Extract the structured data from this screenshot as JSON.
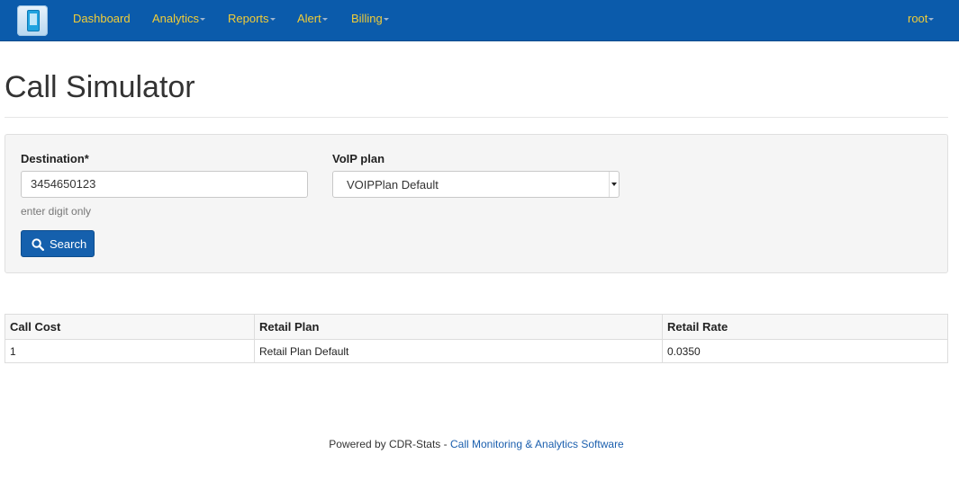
{
  "nav": {
    "items": [
      {
        "label": "Dashboard",
        "dropdown": false
      },
      {
        "label": "Analytics",
        "dropdown": true
      },
      {
        "label": "Reports",
        "dropdown": true
      },
      {
        "label": "Alert",
        "dropdown": true
      },
      {
        "label": "Billing",
        "dropdown": true
      }
    ],
    "user": "root"
  },
  "page": {
    "title": "Call Simulator"
  },
  "form": {
    "destination_label": "Destination*",
    "destination_value": "3454650123",
    "destination_help": "enter digit only",
    "voip_label": "VoIP plan",
    "voip_selected": "VOIPPlan Default",
    "search_label": "Search"
  },
  "table": {
    "headers": [
      "Call Cost",
      "Retail Plan",
      "Retail Rate"
    ],
    "rows": [
      [
        "1",
        "Retail Plan Default",
        "0.0350"
      ]
    ]
  },
  "footer": {
    "prefix": "Powered by CDR-Stats - ",
    "link": "Call Monitoring & Analytics Software"
  },
  "colors": {
    "navbar": "#0b5bab",
    "nav_text": "#f2cd37",
    "button": "#1560ad",
    "link": "#1b5fae"
  }
}
